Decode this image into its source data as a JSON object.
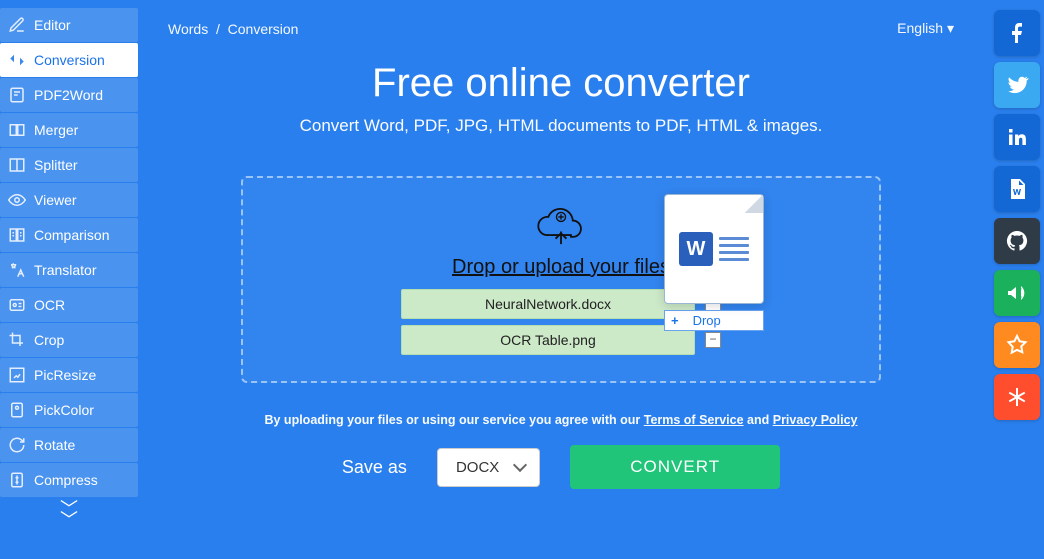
{
  "breadcrumb": {
    "root": "Words",
    "sep": "/",
    "current": "Conversion"
  },
  "language": "English",
  "heading": "Free online converter",
  "subtitle": "Convert Word, PDF, JPG, HTML documents to PDF, HTML & images.",
  "dropzone": {
    "title": "Drop or upload your files",
    "files": [
      {
        "name": "NeuralNetwork.docx"
      },
      {
        "name": "OCR Table.png"
      }
    ],
    "drag_hint": "Drop"
  },
  "agree": {
    "prefix": "By uploading your files or using our service you agree with our ",
    "terms": "Terms of Service",
    "and": " and ",
    "privacy": "Privacy Policy"
  },
  "saveas_label": "Save as",
  "format_selected": "DOCX",
  "convert_label": "CONVERT",
  "sidebar": {
    "items": [
      {
        "label": "Editor",
        "icon": "edit"
      },
      {
        "label": "Conversion",
        "icon": "convert",
        "active": true
      },
      {
        "label": "PDF2Word",
        "icon": "pdf"
      },
      {
        "label": "Merger",
        "icon": "merge"
      },
      {
        "label": "Splitter",
        "icon": "split"
      },
      {
        "label": "Viewer",
        "icon": "eye"
      },
      {
        "label": "Comparison",
        "icon": "compare"
      },
      {
        "label": "Translator",
        "icon": "translate"
      },
      {
        "label": "OCR",
        "icon": "ocr"
      },
      {
        "label": "Crop",
        "icon": "crop"
      },
      {
        "label": "PicResize",
        "icon": "resize"
      },
      {
        "label": "PickColor",
        "icon": "pickcolor"
      },
      {
        "label": "Rotate",
        "icon": "rotate"
      },
      {
        "label": "Compress",
        "icon": "compress"
      }
    ]
  },
  "social": [
    {
      "name": "facebook"
    },
    {
      "name": "twitter"
    },
    {
      "name": "linkedin"
    },
    {
      "name": "word-doc"
    },
    {
      "name": "github"
    },
    {
      "name": "announce"
    },
    {
      "name": "favorite"
    },
    {
      "name": "settings"
    }
  ]
}
